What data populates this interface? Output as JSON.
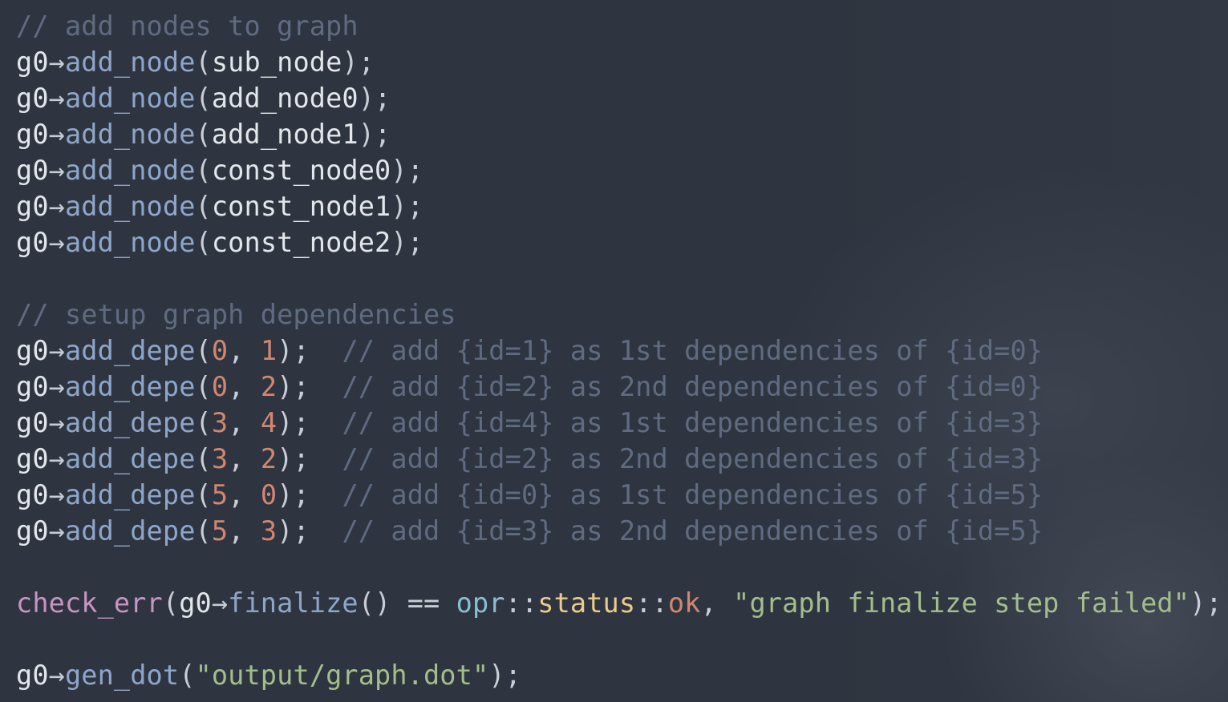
{
  "code": {
    "lines": [
      [
        {
          "t": "// add nodes to graph",
          "k": "comment"
        }
      ],
      [
        {
          "t": "g0",
          "k": "plain"
        },
        {
          "t": "→",
          "k": "op"
        },
        {
          "t": "add_node",
          "k": "func"
        },
        {
          "t": "(",
          "k": "punct"
        },
        {
          "t": "sub_node",
          "k": "plain"
        },
        {
          "t": ");",
          "k": "punct"
        }
      ],
      [
        {
          "t": "g0",
          "k": "plain"
        },
        {
          "t": "→",
          "k": "op"
        },
        {
          "t": "add_node",
          "k": "func"
        },
        {
          "t": "(",
          "k": "punct"
        },
        {
          "t": "add_node0",
          "k": "plain"
        },
        {
          "t": ");",
          "k": "punct"
        }
      ],
      [
        {
          "t": "g0",
          "k": "plain"
        },
        {
          "t": "→",
          "k": "op"
        },
        {
          "t": "add_node",
          "k": "func"
        },
        {
          "t": "(",
          "k": "punct"
        },
        {
          "t": "add_node1",
          "k": "plain"
        },
        {
          "t": ");",
          "k": "punct"
        }
      ],
      [
        {
          "t": "g0",
          "k": "plain"
        },
        {
          "t": "→",
          "k": "op"
        },
        {
          "t": "add_node",
          "k": "func"
        },
        {
          "t": "(",
          "k": "punct"
        },
        {
          "t": "const_node0",
          "k": "plain"
        },
        {
          "t": ");",
          "k": "punct"
        }
      ],
      [
        {
          "t": "g0",
          "k": "plain"
        },
        {
          "t": "→",
          "k": "op"
        },
        {
          "t": "add_node",
          "k": "func"
        },
        {
          "t": "(",
          "k": "punct"
        },
        {
          "t": "const_node1",
          "k": "plain"
        },
        {
          "t": ");",
          "k": "punct"
        }
      ],
      [
        {
          "t": "g0",
          "k": "plain"
        },
        {
          "t": "→",
          "k": "op"
        },
        {
          "t": "add_node",
          "k": "func"
        },
        {
          "t": "(",
          "k": "punct"
        },
        {
          "t": "const_node2",
          "k": "plain"
        },
        {
          "t": ");",
          "k": "punct"
        }
      ],
      [],
      [
        {
          "t": "// setup graph dependencies",
          "k": "comment"
        }
      ],
      [
        {
          "t": "g0",
          "k": "plain"
        },
        {
          "t": "→",
          "k": "op"
        },
        {
          "t": "add_depe",
          "k": "func"
        },
        {
          "t": "(",
          "k": "punct"
        },
        {
          "t": "0",
          "k": "num"
        },
        {
          "t": ", ",
          "k": "punct"
        },
        {
          "t": "1",
          "k": "num"
        },
        {
          "t": ");  ",
          "k": "punct"
        },
        {
          "t": "// add {id=1} as 1st dependencies of {id=0}",
          "k": "comment"
        }
      ],
      [
        {
          "t": "g0",
          "k": "plain"
        },
        {
          "t": "→",
          "k": "op"
        },
        {
          "t": "add_depe",
          "k": "func"
        },
        {
          "t": "(",
          "k": "punct"
        },
        {
          "t": "0",
          "k": "num"
        },
        {
          "t": ", ",
          "k": "punct"
        },
        {
          "t": "2",
          "k": "num"
        },
        {
          "t": ");  ",
          "k": "punct"
        },
        {
          "t": "// add {id=2} as 2nd dependencies of {id=0}",
          "k": "comment"
        }
      ],
      [
        {
          "t": "g0",
          "k": "plain"
        },
        {
          "t": "→",
          "k": "op"
        },
        {
          "t": "add_depe",
          "k": "func"
        },
        {
          "t": "(",
          "k": "punct"
        },
        {
          "t": "3",
          "k": "num"
        },
        {
          "t": ", ",
          "k": "punct"
        },
        {
          "t": "4",
          "k": "num"
        },
        {
          "t": ");  ",
          "k": "punct"
        },
        {
          "t": "// add {id=4} as 1st dependencies of {id=3}",
          "k": "comment"
        }
      ],
      [
        {
          "t": "g0",
          "k": "plain"
        },
        {
          "t": "→",
          "k": "op"
        },
        {
          "t": "add_depe",
          "k": "func"
        },
        {
          "t": "(",
          "k": "punct"
        },
        {
          "t": "3",
          "k": "num"
        },
        {
          "t": ", ",
          "k": "punct"
        },
        {
          "t": "2",
          "k": "num"
        },
        {
          "t": ");  ",
          "k": "punct"
        },
        {
          "t": "// add {id=2} as 2nd dependencies of {id=3}",
          "k": "comment"
        }
      ],
      [
        {
          "t": "g0",
          "k": "plain"
        },
        {
          "t": "→",
          "k": "op"
        },
        {
          "t": "add_depe",
          "k": "func"
        },
        {
          "t": "(",
          "k": "punct"
        },
        {
          "t": "5",
          "k": "num"
        },
        {
          "t": ", ",
          "k": "punct"
        },
        {
          "t": "0",
          "k": "num"
        },
        {
          "t": ");  ",
          "k": "punct"
        },
        {
          "t": "// add {id=0} as 1st dependencies of {id=5}",
          "k": "comment"
        }
      ],
      [
        {
          "t": "g0",
          "k": "plain"
        },
        {
          "t": "→",
          "k": "op"
        },
        {
          "t": "add_depe",
          "k": "func"
        },
        {
          "t": "(",
          "k": "punct"
        },
        {
          "t": "5",
          "k": "num"
        },
        {
          "t": ", ",
          "k": "punct"
        },
        {
          "t": "3",
          "k": "num"
        },
        {
          "t": ");  ",
          "k": "punct"
        },
        {
          "t": "// add {id=3} as 2nd dependencies of {id=5}",
          "k": "comment"
        }
      ],
      [],
      [
        {
          "t": "check_err",
          "k": "mac"
        },
        {
          "t": "(",
          "k": "punct"
        },
        {
          "t": "g0",
          "k": "plain"
        },
        {
          "t": "→",
          "k": "op"
        },
        {
          "t": "finalize",
          "k": "func"
        },
        {
          "t": "() ",
          "k": "punct"
        },
        {
          "t": "==",
          "k": "op"
        },
        {
          "t": " ",
          "k": "punct"
        },
        {
          "t": "opr",
          "k": "ns"
        },
        {
          "t": "::",
          "k": "op"
        },
        {
          "t": "status",
          "k": "type"
        },
        {
          "t": "::",
          "k": "op"
        },
        {
          "t": "ok",
          "k": "const"
        },
        {
          "t": ", ",
          "k": "punct"
        },
        {
          "t": "\"graph finalize step failed\"",
          "k": "str"
        },
        {
          "t": ");",
          "k": "punct"
        }
      ],
      [],
      [
        {
          "t": "g0",
          "k": "plain"
        },
        {
          "t": "→",
          "k": "op"
        },
        {
          "t": "gen_dot",
          "k": "func"
        },
        {
          "t": "(",
          "k": "punct"
        },
        {
          "t": "\"output/graph.dot\"",
          "k": "str"
        },
        {
          "t": ");",
          "k": "punct"
        }
      ]
    ]
  },
  "colors": {
    "background": "#2f3540",
    "plain": "#e3e6eb",
    "function": "#8fa6c9",
    "number": "#d08770",
    "comment": "#5f6b80",
    "string": "#a3be8c",
    "macro": "#c993c2",
    "namespace": "#88c0d0",
    "type": "#ebcb8b"
  }
}
